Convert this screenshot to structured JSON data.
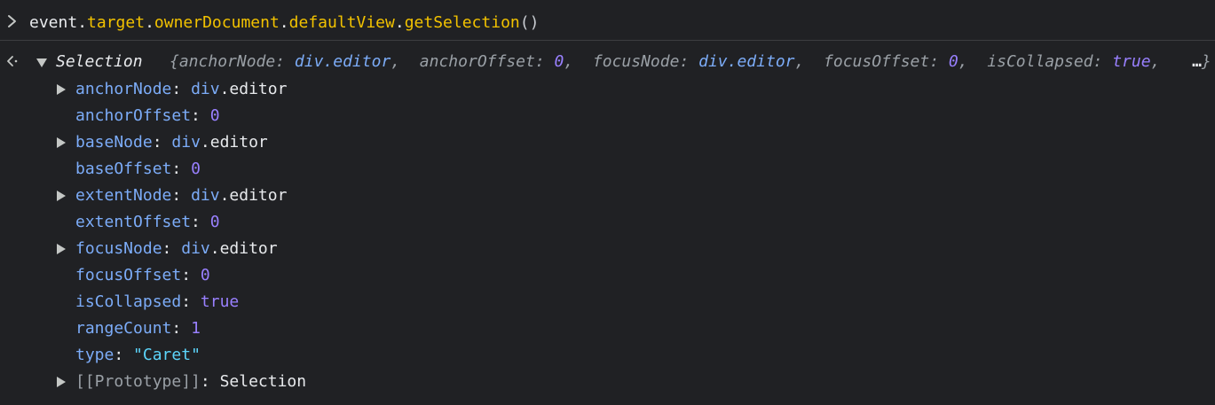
{
  "console": {
    "input": {
      "tokens": [
        {
          "text": "event",
          "kind": "plain"
        },
        {
          "text": ".",
          "kind": "punct"
        },
        {
          "text": "target",
          "kind": "prop"
        },
        {
          "text": ".",
          "kind": "punct"
        },
        {
          "text": "ownerDocument",
          "kind": "prop"
        },
        {
          "text": ".",
          "kind": "punct"
        },
        {
          "text": "defaultView",
          "kind": "prop"
        },
        {
          "text": ".",
          "kind": "punct"
        },
        {
          "text": "getSelection",
          "kind": "method"
        },
        {
          "text": "()",
          "kind": "paren"
        }
      ]
    },
    "result": {
      "class_name": "Selection",
      "summary": {
        "open_brace": "{",
        "items": [
          {
            "key": "anchorNode",
            "value": "div.editor",
            "kind": "node"
          },
          {
            "key": "anchorOffset",
            "value": "0",
            "kind": "num"
          },
          {
            "key": "focusNode",
            "value": "div.editor",
            "kind": "node"
          },
          {
            "key": "focusOffset",
            "value": "0",
            "kind": "num"
          },
          {
            "key": "isCollapsed",
            "value": "true",
            "kind": "num"
          }
        ],
        "ellipsis": "…",
        "close_brace": "}"
      },
      "properties": [
        {
          "key": "anchorNode",
          "value": "div.editor",
          "kind": "node",
          "expandable": true
        },
        {
          "key": "anchorOffset",
          "value": "0",
          "kind": "num",
          "expandable": false
        },
        {
          "key": "baseNode",
          "value": "div.editor",
          "kind": "node",
          "expandable": true
        },
        {
          "key": "baseOffset",
          "value": "0",
          "kind": "num",
          "expandable": false
        },
        {
          "key": "extentNode",
          "value": "div.editor",
          "kind": "node",
          "expandable": true
        },
        {
          "key": "extentOffset",
          "value": "0",
          "kind": "num",
          "expandable": false
        },
        {
          "key": "focusNode",
          "value": "div.editor",
          "kind": "node",
          "expandable": true
        },
        {
          "key": "focusOffset",
          "value": "0",
          "kind": "num",
          "expandable": false
        },
        {
          "key": "isCollapsed",
          "value": "true",
          "kind": "bool",
          "expandable": false
        },
        {
          "key": "rangeCount",
          "value": "1",
          "kind": "num",
          "expandable": false
        },
        {
          "key": "type",
          "value": "\"Caret\"",
          "kind": "str",
          "expandable": false
        },
        {
          "key": "[[Prototype]]",
          "value": "Selection",
          "kind": "plain",
          "expandable": true,
          "dim_key": true
        }
      ]
    },
    "icons": {
      "prompt": "chevron-right-icon",
      "result": "result-arrow-icon",
      "expand": "triangle-right-icon",
      "collapse": "triangle-down-icon"
    },
    "colors": {
      "background": "#202124",
      "property_key": "#7cacf8",
      "number": "#9980ff",
      "string": "#5cd5fb",
      "method": "#f2c200"
    }
  }
}
